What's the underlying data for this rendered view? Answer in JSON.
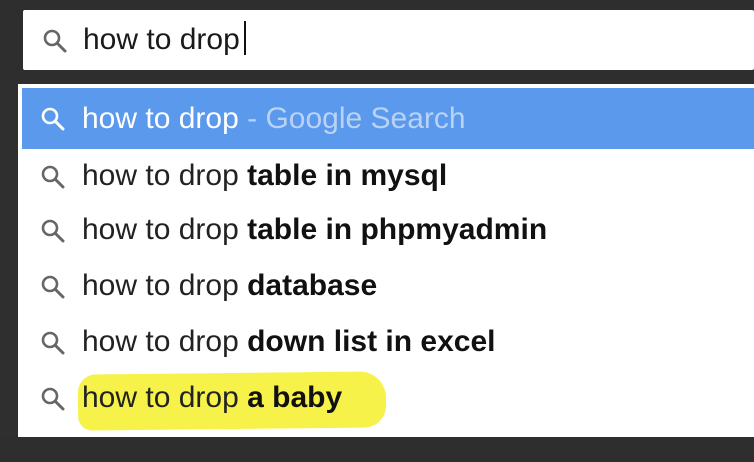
{
  "search": {
    "query": "how to drop"
  },
  "suggestions": [
    {
      "prefix": "how to drop",
      "bold": "",
      "suffix": " - Google Search",
      "icon": "search-icon"
    },
    {
      "prefix": "how to drop ",
      "bold": "table in mysql",
      "suffix": "",
      "icon": "search-icon"
    },
    {
      "prefix": "how to drop ",
      "bold": "table in phpmyadmin",
      "suffix": "",
      "icon": "search-icon"
    },
    {
      "prefix": "how to drop ",
      "bold": "database",
      "suffix": "",
      "icon": "search-icon"
    },
    {
      "prefix": "how to drop ",
      "bold": "down list in excel",
      "suffix": "",
      "icon": "search-icon"
    },
    {
      "prefix": "how to drop ",
      "bold": "a baby",
      "suffix": "",
      "icon": "search-icon"
    }
  ],
  "colors": {
    "selected_bg": "#5b99ec",
    "highlight": "#f6f24a",
    "frame": "#2e2e2e"
  }
}
